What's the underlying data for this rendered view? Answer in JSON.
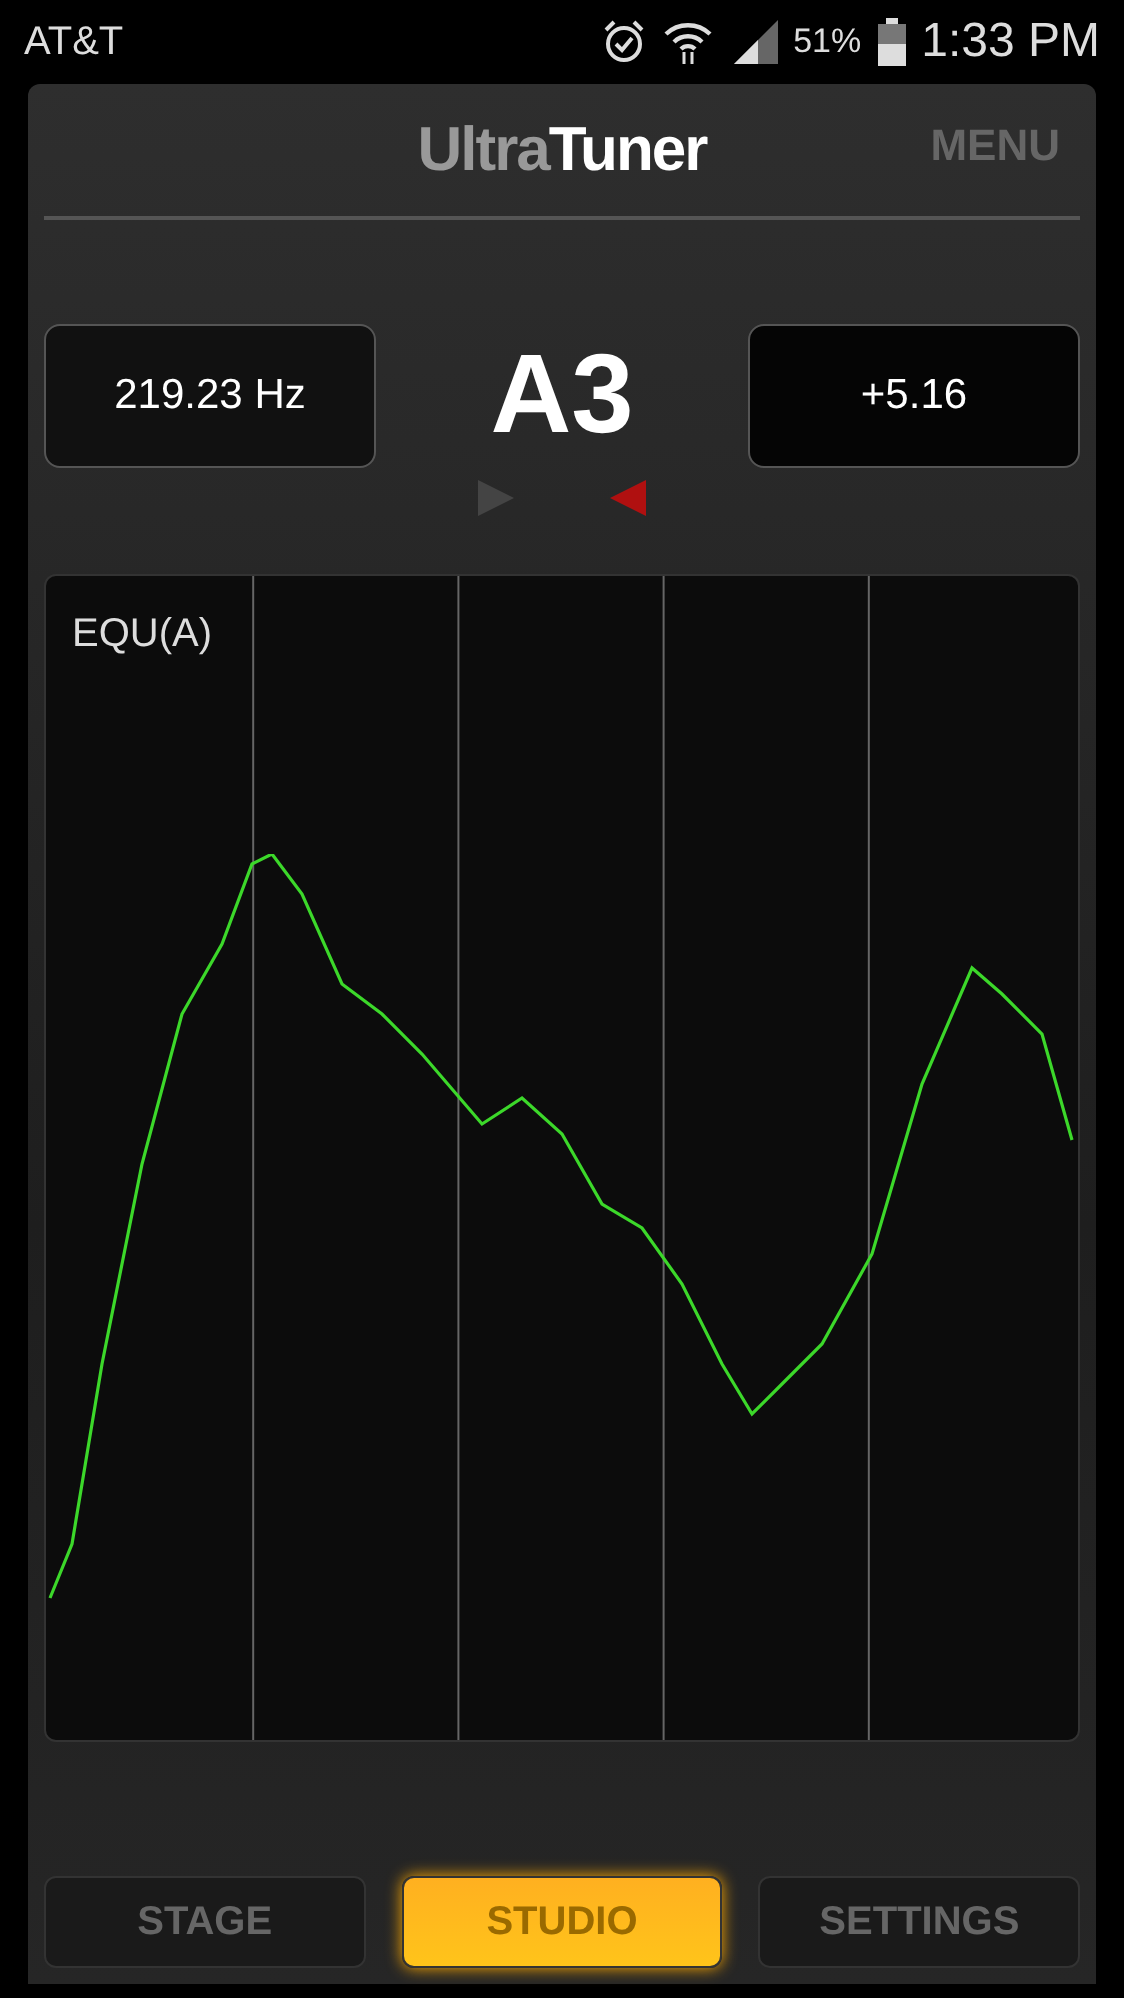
{
  "status_bar": {
    "carrier": "AT&T",
    "battery": "51%",
    "time": "1:33 PM"
  },
  "header": {
    "logo_dim": "Ultra",
    "logo_bright": "Tuner",
    "menu": "MENU"
  },
  "frequency": "219.23 Hz",
  "note": "A3",
  "cents": "+5.16",
  "indicators": [
    {
      "kind": "sharp",
      "lit": false
    },
    {
      "kind": "flat",
      "lit": true
    }
  ],
  "graph": {
    "label": "EQU(A)"
  },
  "tabs": [
    {
      "label": "STAGE",
      "selected": false
    },
    {
      "label": "STUDIO",
      "selected": true
    },
    {
      "label": "SETTINGS",
      "selected": false
    }
  ]
}
